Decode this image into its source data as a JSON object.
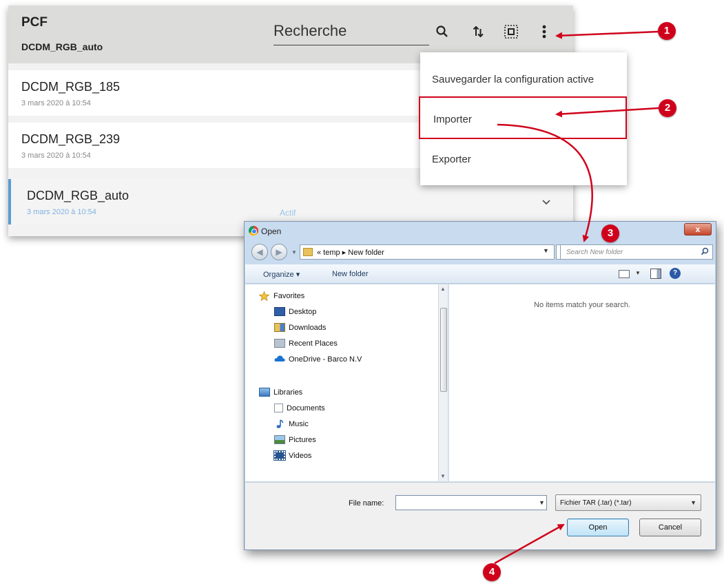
{
  "pcf": {
    "title": "PCF",
    "subtitle": "DCDM_RGB_auto",
    "search_placeholder": "Recherche",
    "items": [
      {
        "name": "DCDM_RGB_185",
        "date": "3 mars 2020 à 10:54"
      },
      {
        "name": "DCDM_RGB_239",
        "date": "3 mars 2020 à 10:54"
      },
      {
        "name": "DCDM_RGB_auto",
        "date": "3 mars 2020 à 10:54",
        "status": "Actif"
      }
    ]
  },
  "menu": {
    "items": [
      {
        "label": "Sauvegarder la configuration active"
      },
      {
        "label": "Importer"
      },
      {
        "label": "Exporter"
      }
    ]
  },
  "dialog": {
    "title": "Open",
    "close_label": "x",
    "address_path": "« temp ▸ New folder",
    "search_placeholder": "Search New folder",
    "toolbar": {
      "organize": "Organize ▾",
      "new_folder": "New folder",
      "help": "?"
    },
    "favorites": {
      "header": "Favorites",
      "items": [
        "Desktop",
        "Downloads",
        "Recent Places",
        "OneDrive - Barco N.V"
      ]
    },
    "libraries": {
      "header": "Libraries",
      "items": [
        "Documents",
        "Music",
        "Pictures",
        "Videos"
      ]
    },
    "empty_message": "No items match your search.",
    "file_name_label": "File name:",
    "file_name_value": "",
    "file_type": "Fichier TAR (.tar) (*.tar)",
    "open_label": "Open",
    "cancel_label": "Cancel"
  },
  "callouts": [
    "1",
    "2",
    "3",
    "4"
  ],
  "colors": {
    "callout": "#d0021b",
    "active_accent": "#5b9bd5",
    "header_bg": "#dcdcda"
  }
}
